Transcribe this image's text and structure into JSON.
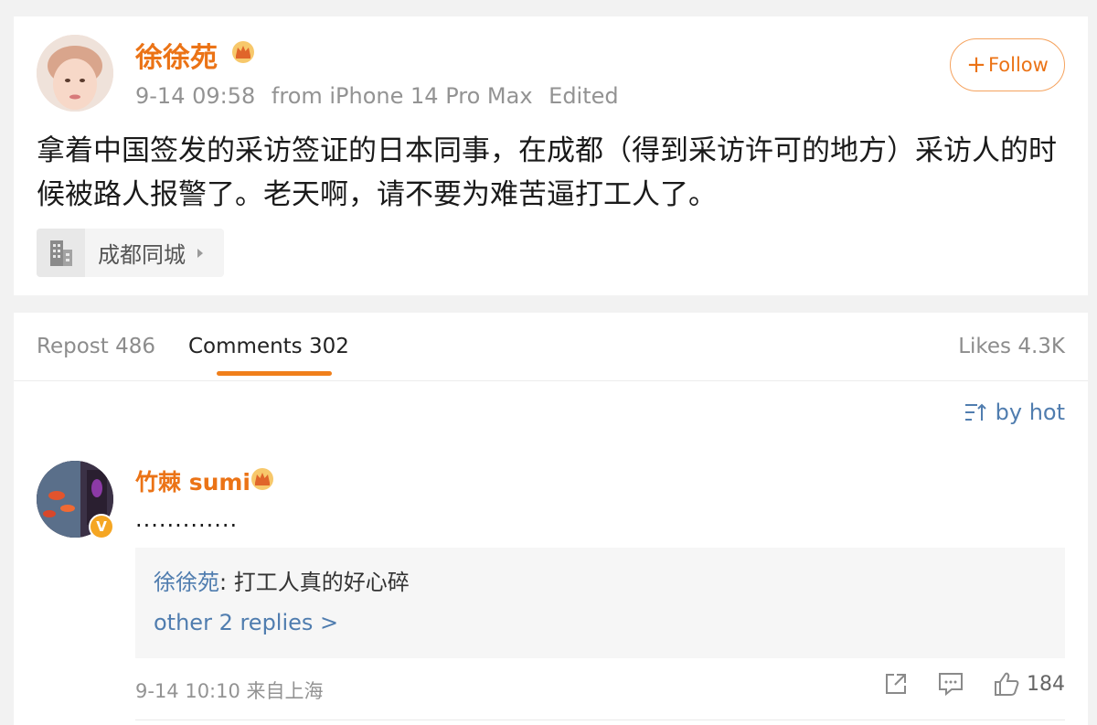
{
  "post": {
    "author_name": "徐徐苑",
    "author_badge_icon": "crown-icon",
    "timestamp": "9-14 09:58",
    "source": "from iPhone 14 Pro Max",
    "edited_label": "Edited",
    "follow_label": "Follow",
    "text": "拿着中国签发的采访签证的日本同事，在成都（得到采访许可的地方）采访人的时候被路人报警了。老天啊，请不要为难苦逼打工人了。",
    "location_tag": "成都同城"
  },
  "tabs": {
    "repost": "Repost 486",
    "comments": "Comments 302",
    "likes": "Likes 4.3K"
  },
  "sort": {
    "label": "by hot"
  },
  "comment": {
    "author_name": "竹棘 sumi",
    "verified_badge": "V",
    "text": ".............",
    "reply": {
      "author": "徐徐苑",
      "separator": ": ",
      "text": "打工人真的好心碎",
      "more_label": "other 2 replies >"
    },
    "timestamp": "9-14 10:10",
    "location": "来自上海",
    "like_count": "184"
  },
  "colors": {
    "accent_orange": "#eb7316",
    "link_blue": "#507daf",
    "background": "#f2f2f2"
  }
}
